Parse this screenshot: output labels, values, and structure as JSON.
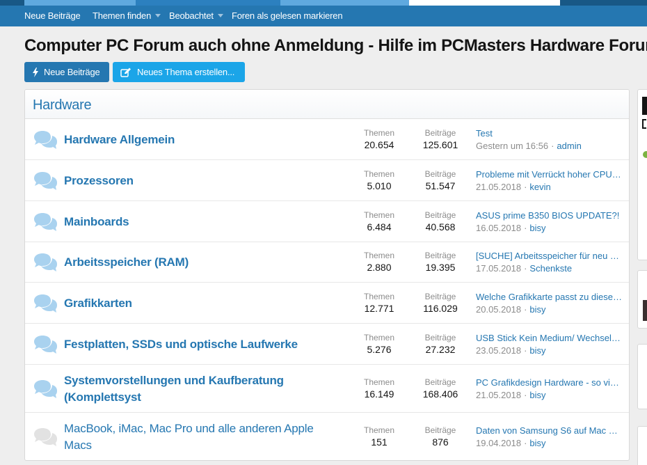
{
  "nav": {
    "items": [
      {
        "label": "Neue Beiträge",
        "has_caret": false
      },
      {
        "label": "Themen finden",
        "has_caret": true
      },
      {
        "label": "Beobachtet",
        "has_caret": true
      },
      {
        "label": "Foren als gelesen markieren",
        "has_caret": false
      }
    ]
  },
  "page": {
    "title": "Computer PC Forum auch ohne Anmeldung - Hilfe im PCMasters Hardware Forum"
  },
  "buttons": {
    "new_posts": "Neue Beiträge",
    "new_thread": "Neues Thema erstellen..."
  },
  "category": {
    "title": "Hardware",
    "stat_label_threads": "Themen",
    "stat_label_posts": "Beiträge",
    "forums": [
      {
        "name": "Hardware Allgemein",
        "threads": "20.654",
        "posts": "125.601",
        "latest_title": "Test",
        "latest_date": "Gestern um 16:56",
        "latest_user": "admin",
        "unread": true
      },
      {
        "name": "Prozessoren",
        "threads": "5.010",
        "posts": "51.547",
        "latest_title": "Probleme mit Verrückt hoher CPU…",
        "latest_date": "21.05.2018",
        "latest_user": "kevin",
        "unread": true
      },
      {
        "name": "Mainboards",
        "threads": "6.484",
        "posts": "40.568",
        "latest_title": "ASUS prime B350 BIOS UPDATE?!",
        "latest_date": "16.05.2018",
        "latest_user": "bisy",
        "unread": true
      },
      {
        "name": "Arbeitsspeicher (RAM)",
        "threads": "2.880",
        "posts": "19.395",
        "latest_title": "[SUCHE] Arbeitsspeicher für neu …",
        "latest_date": "17.05.2018",
        "latest_user": "Schenkste",
        "unread": true
      },
      {
        "name": "Grafikkarten",
        "threads": "12.771",
        "posts": "116.029",
        "latest_title": "Welche Grafikkarte passt zu diese…",
        "latest_date": "20.05.2018",
        "latest_user": "bisy",
        "unread": true
      },
      {
        "name": "Festplatten, SSDs und optische Laufwerke",
        "threads": "5.276",
        "posts": "27.232",
        "latest_title": "USB Stick Kein Medium/ Wechsel…",
        "latest_date": "23.05.2018",
        "latest_user": "bisy",
        "unread": true
      },
      {
        "name_line1": "Systemvorstellungen und Kaufberatung",
        "name_line2": "(Komplettsyst",
        "threads": "16.149",
        "posts": "168.406",
        "latest_title": "PC Grafikdesign Hardware - so vi…",
        "latest_date": "21.05.2018",
        "latest_user": "bisy",
        "unread": true
      },
      {
        "name_line1": "MacBook, iMac, Mac Pro und alle anderen Apple",
        "name_line2": "Macs",
        "threads": "151",
        "posts": "876",
        "latest_title": "Daten von Samsung S6 auf Mac …",
        "latest_date": "19.04.2018",
        "latest_user": "bisy",
        "unread": false
      }
    ]
  },
  "meta_separator": "·",
  "colors": {
    "nav_bg": "#2577b1",
    "link": "#2577b1",
    "button_primary": "#2577b1",
    "button_accent": "#1ba5e8",
    "icon_unread": "#a9d2ef",
    "icon_read": "#e2e2e2"
  },
  "icons": {
    "forum": "speech-bubbles-icon",
    "bolt": "bolt-icon",
    "edit": "edit-icon",
    "caret": "caret-down-icon"
  }
}
